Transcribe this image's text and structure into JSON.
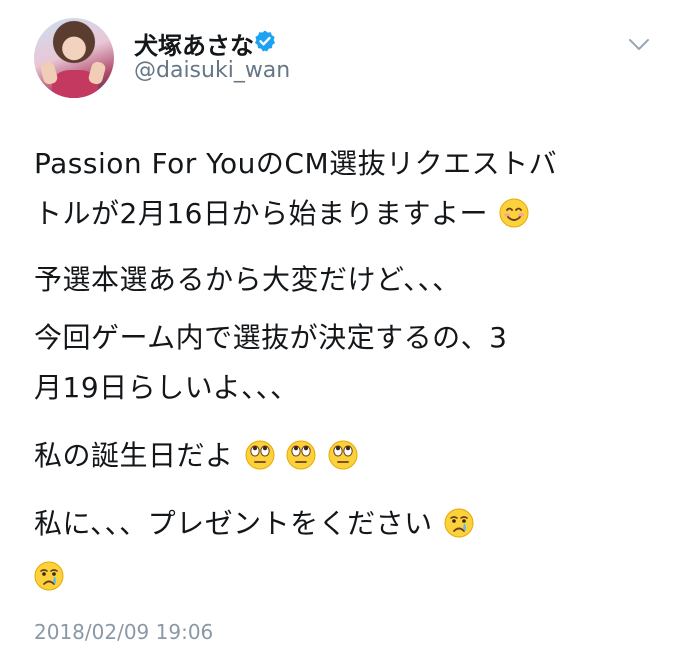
{
  "author": {
    "display_name": "犬塚あさな",
    "handle": "@daisuki_wan",
    "verified_icon": "verified-badge-icon",
    "avatar": "user-avatar"
  },
  "menu_icon": "chevron-down-icon",
  "tweet": {
    "lines": [
      "Passion For YouのCM選抜リクエストバ",
      "トルが2月16日から始まりますよー",
      "予選本選あるから大変だけど、、、",
      "今回ゲーム内で選抜が決定するの、3",
      "月19日らしいよ、、、",
      "私の誕生日だよ",
      "私に、、、プレゼントをください"
    ],
    "emojis": [
      "smiling-face-icon",
      "rolling-eyes-icon",
      "crying-face-icon"
    ]
  },
  "timestamp": "2018/02/09 19:06",
  "colors": {
    "text": "#14171a",
    "secondary": "#657786",
    "verified": "#1da1f2",
    "timestamp": "#8b98a5"
  }
}
